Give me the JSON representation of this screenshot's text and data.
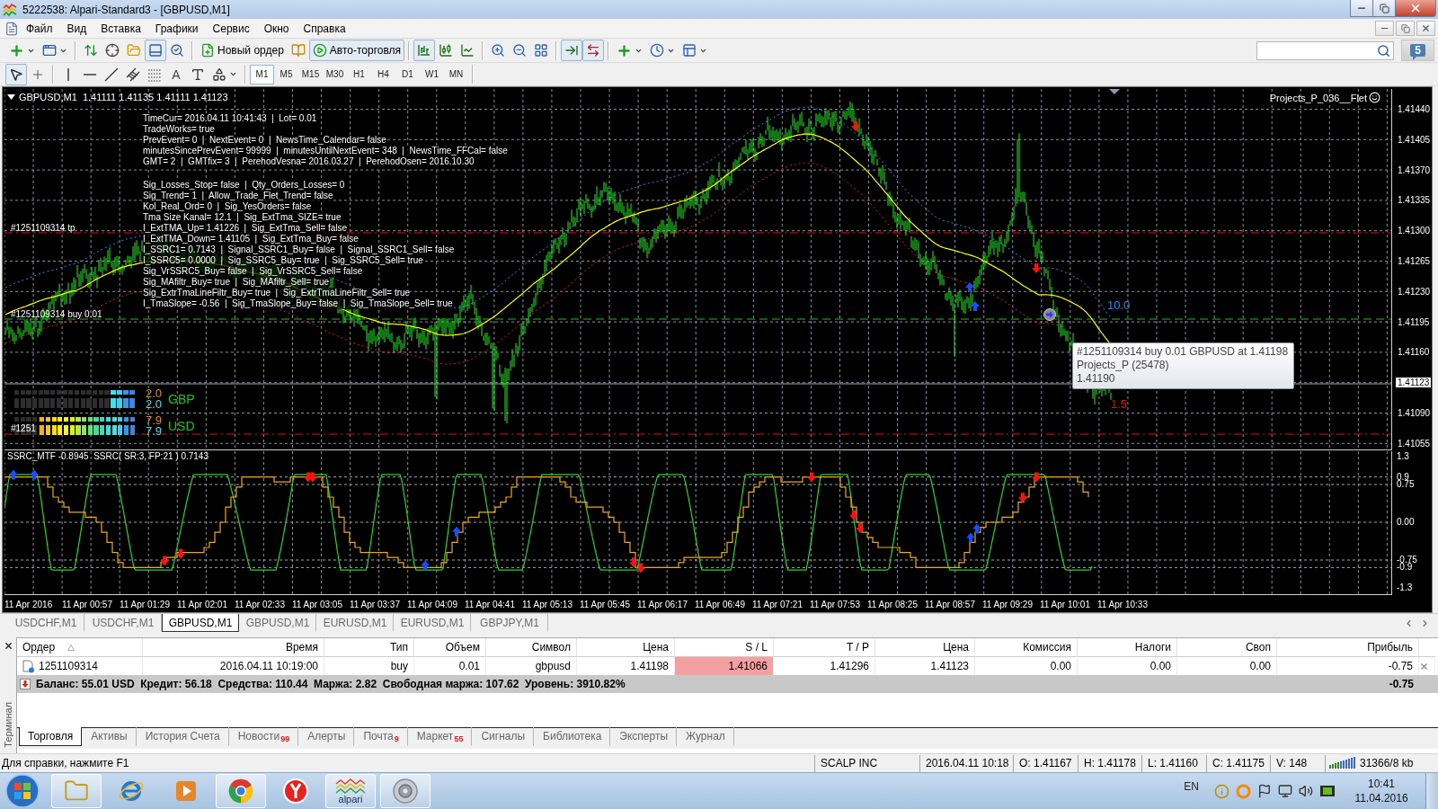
{
  "window": {
    "title": "5222538: Alpari-Standard3 - [GBPUSD,M1]"
  },
  "menu": [
    "Файл",
    "Вид",
    "Вставка",
    "Графики",
    "Сервис",
    "Окно",
    "Справка"
  ],
  "toolbar": {
    "groups": [
      [
        {
          "kind": "new-chart",
          "pressed": false
        },
        {
          "kind": "profiles",
          "pressed": false
        }
      ],
      [
        {
          "kind": "market-watch",
          "pressed": false
        },
        {
          "kind": "data-window",
          "pressed": false
        },
        {
          "kind": "navigator",
          "pressed": false
        },
        {
          "kind": "terminal",
          "pressed": true
        },
        {
          "kind": "tester",
          "pressed": false
        }
      ],
      [
        {
          "kind": "new-order",
          "label": "Новый ордер",
          "pressed": false
        },
        {
          "kind": "metaeditor",
          "pressed": false
        },
        {
          "kind": "auto-trading",
          "label": "Авто-торговля",
          "pressed": true
        }
      ],
      [
        {
          "kind": "bar-chart",
          "pressed": true
        },
        {
          "kind": "candles",
          "pressed": false
        },
        {
          "kind": "line-chart",
          "pressed": false
        }
      ],
      [
        {
          "kind": "zoom-in",
          "pressed": false
        },
        {
          "kind": "zoom-out",
          "pressed": false
        },
        {
          "kind": "tile",
          "pressed": false
        }
      ],
      [
        {
          "kind": "auto-scroll",
          "pressed": true
        },
        {
          "kind": "chart-shift",
          "pressed": true
        }
      ],
      [
        {
          "kind": "indicators",
          "pressed": false
        },
        {
          "kind": "periods",
          "pressed": false
        },
        {
          "kind": "templates",
          "pressed": false
        }
      ]
    ],
    "messages": "5"
  },
  "tools": {
    "groups": [
      [
        {
          "kind": "cursor",
          "pressed": true
        },
        {
          "kind": "crosshair",
          "pressed": false
        }
      ],
      [
        {
          "kind": "vertical-line",
          "pressed": false
        },
        {
          "kind": "horizontal-line",
          "pressed": false
        },
        {
          "kind": "trend-line",
          "pressed": false
        },
        {
          "kind": "channel",
          "pressed": false
        },
        {
          "kind": "fibonacci",
          "pressed": false
        },
        {
          "kind": "text",
          "label": "A",
          "pressed": false
        },
        {
          "kind": "text-label",
          "pressed": false
        },
        {
          "kind": "arrows",
          "pressed": false
        }
      ]
    ],
    "periods": [
      {
        "label": "M1",
        "selected": true
      },
      {
        "label": "M5",
        "selected": false
      },
      {
        "label": "M15",
        "selected": false
      },
      {
        "label": "M30",
        "selected": false
      },
      {
        "label": "H1",
        "selected": false
      },
      {
        "label": "H4",
        "selected": false
      },
      {
        "label": "D1",
        "selected": false
      },
      {
        "label": "W1",
        "selected": false
      },
      {
        "label": "MN",
        "selected": false
      }
    ]
  },
  "chart": {
    "header": "GBPUSD,M1  1.41111 1.41135 1.41111 1.41123",
    "expert": "Projects_P_036__Flet",
    "info_blocks": [
      [
        "TimeCur= 2016.04.11 10:41:43  |  Lot= 0.01",
        "TradeWorks= true",
        "PrevEvent= 0  |  NextEvent= 0  |  NewsTime_Calendar= false",
        "minutesSincePrevEvent= 99999  |  minutesUntilNextEvent= 348  |  NewsTime_FFCal= false",
        "GMT= 2  |  GMTfix= 3  |  PerehodVesna= 2016.03.27  |  PerehodOsen= 2016.10.30"
      ],
      [
        "Sig_Losses_Stop= false  |  Qty_Orders_Losses= 0",
        "Sig_Trend= 1  |  Allow_Trade_Flet_Trend= false",
        "Kol_Real_Ord= 0  |  Sig_YesOrders= false",
        "Tma Size Kanal= 12.1  |  Sig_ExtTma_SIZE= true",
        "I_ExtTMA_Up= 1.41226  |  Sig_ExtTma_Sell= false",
        "I_ExtTMA_Down= 1.41105  |  Sig_ExtTma_Buy= false",
        "I_SSRC1= 0.7143  |  Signal_SSRC1_Buy= false  |  Signal_SSRC1_Sell= false",
        "I_SSRC5= 0.0000  |  Sig_SSRC5_Buy= true  |  Sig_SSRC5_Sell= true",
        "Sig_VrSSRC5_Buy= false  |  Sig_VrSSRC5_Sell= false",
        "Sig_MAfiltr_Buy= true  |  Sig_MAfiltr_Sell= true",
        "Sig_ExtrTmaLineFiltr_Buy= true  |  Sig_ExtrTmaLineFiltr_Sell= true",
        "I_TmaSlope= -0.56  |  Sig_TmaSlope_Buy= false  |  Sig_TmaSlope_Sell= true"
      ]
    ],
    "order_labels": [
      {
        "kind": "tp",
        "text": "#1251109314 tp"
      },
      {
        "kind": "buy",
        "text": "#1251109314 buy 0.01"
      },
      {
        "kind": "sl",
        "text": "#1251"
      }
    ],
    "strength": [
      {
        "currency": "GBP",
        "rows": [
          {
            "value": "2.0",
            "level": 0.2
          },
          {
            "value": "2.0",
            "level": 0.2
          }
        ]
      },
      {
        "currency": "USD",
        "rows": [
          {
            "value": "7.9",
            "level": 0.79
          },
          {
            "value": "7.9",
            "level": 0.79
          }
        ]
      }
    ],
    "markers": [
      {
        "kind": "upper",
        "text": "10.0"
      },
      {
        "kind": "lower",
        "text": "1.5"
      }
    ],
    "tooltip": [
      "#1251109314 buy 0.01 GBPUSD at 1.41198",
      "Projects_P (25478)",
      "1.41190"
    ],
    "price_axis": [
      {
        "label": "1.41440",
        "kind": "tick"
      },
      {
        "label": "1.41405",
        "kind": "tick"
      },
      {
        "label": "1.41370",
        "kind": "tick"
      },
      {
        "label": "1.41335",
        "kind": "tick"
      },
      {
        "label": "1.41300",
        "kind": "tick"
      },
      {
        "label": "1.41265",
        "kind": "tick"
      },
      {
        "label": "1.41230",
        "kind": "tick"
      },
      {
        "label": "1.41195",
        "kind": "tick"
      },
      {
        "label": "1.41160",
        "kind": "tick"
      },
      {
        "label": "1.41123",
        "kind": "current"
      },
      {
        "label": "1.41090",
        "kind": "tick"
      },
      {
        "label": "1.41055",
        "kind": "tick"
      }
    ],
    "indicator": {
      "title": "SSRC_MTF -0.8945  SSRC( SR:3, FP:21 ) 0.7143",
      "levels": [
        "1.3",
        "0.9",
        "0.75",
        "0.00",
        "-0.75",
        "-0.9",
        "-1.3"
      ]
    },
    "time_axis": [
      "11 Apr 2016",
      "11 Apr 00:57",
      "11 Apr 01:29",
      "11 Apr 02:01",
      "11 Apr 02:33",
      "11 Apr 03:05",
      "11 Apr 03:37",
      "11 Apr 04:09",
      "11 Apr 04:41",
      "11 Apr 05:13",
      "11 Apr 05:45",
      "11 Apr 06:17",
      "11 Apr 06:49",
      "11 Apr 07:21",
      "11 Apr 07:53",
      "11 Apr 08:25",
      "11 Apr 08:57",
      "11 Apr 09:29",
      "11 Apr 10:01",
      "11 Apr 10:33"
    ]
  },
  "chart_tabs": [
    {
      "label": "USDCHF,M1",
      "selected": false
    },
    {
      "label": "USDCHF,M1",
      "selected": false
    },
    {
      "label": "GBPUSD,M1",
      "selected": true
    },
    {
      "label": "GBPUSD,M1",
      "selected": false
    },
    {
      "label": "EURUSD,M1",
      "selected": false
    },
    {
      "label": "EURUSD,M1",
      "selected": false
    },
    {
      "label": "GBPJPY,M1",
      "selected": false
    }
  ],
  "terminal": {
    "title": "Терминал",
    "columns": [
      "Ордер",
      "Время",
      "Тип",
      "Объем",
      "Символ",
      "Цена",
      "S / L",
      "T / P",
      "Цена",
      "Комиссия",
      "Налоги",
      "Своп",
      "Прибыль"
    ],
    "rows": [
      {
        "cells": [
          {
            "text": "1251109314",
            "alert": false
          },
          {
            "text": "2016.04.11 10:19:00",
            "alert": false
          },
          {
            "text": "buy",
            "alert": false
          },
          {
            "text": "0.01",
            "alert": false
          },
          {
            "text": "gbpusd",
            "alert": false
          },
          {
            "text": "1.41198",
            "alert": false
          },
          {
            "text": "1.41066",
            "alert": true
          },
          {
            "text": "1.41296",
            "alert": false
          },
          {
            "text": "1.41123",
            "alert": false
          },
          {
            "text": "0.00",
            "alert": false
          },
          {
            "text": "0.00",
            "alert": false
          },
          {
            "text": "0.00",
            "alert": false
          },
          {
            "text": "-0.75",
            "alert": false
          }
        ]
      }
    ],
    "summary": {
      "text": "Баланс: 55.01 USD  Кредит: 56.18  Средства: 110.44  Маржа: 2.82  Свободная маржа: 107.62  Уровень: 3910.82%",
      "total": "-0.75"
    },
    "tabs": [
      {
        "label": "Торговля",
        "selected": true
      },
      {
        "label": "Активы",
        "selected": false
      },
      {
        "label": "История Счета",
        "selected": false
      },
      {
        "label": "Новости",
        "count": "99",
        "selected": false
      },
      {
        "label": "Алерты",
        "selected": false
      },
      {
        "label": "Почта",
        "count": "9",
        "selected": false
      },
      {
        "label": "Маркет",
        "count": "55",
        "selected": false
      },
      {
        "label": "Сигналы",
        "selected": false
      },
      {
        "label": "Библиотека",
        "selected": false
      },
      {
        "label": "Эксперты",
        "selected": false
      },
      {
        "label": "Журнал",
        "selected": false
      }
    ]
  },
  "status_bar": {
    "help": "Для справки, нажмите F1",
    "fields": [
      "SCALP INC",
      "2016.04.11 10:18",
      "O: 1.41167",
      "H: 1.41178",
      "L: 1.41160",
      "C: 1.41175",
      "V: 148"
    ],
    "traffic": "31366/8 kb"
  },
  "taskbar": {
    "apps": [
      {
        "kind": "explorer",
        "running": true
      },
      {
        "kind": "browser",
        "running": false
      },
      {
        "kind": "media",
        "running": false
      },
      {
        "kind": "chrome",
        "running": true
      },
      {
        "kind": "yandex",
        "running": false
      },
      {
        "kind": "alpari",
        "label": "alpari",
        "running": true
      },
      {
        "kind": "sound",
        "running": true
      }
    ],
    "language": "EN",
    "time": "10:41",
    "date": "11.04.2016"
  }
}
